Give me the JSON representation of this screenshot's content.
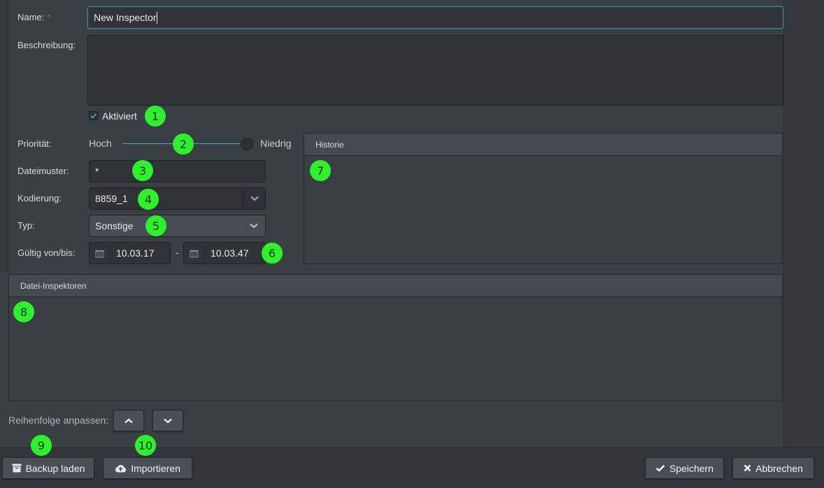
{
  "form": {
    "name_label": "Name:",
    "required_marker": "*",
    "name_value": "New Inspector",
    "description_label": "Beschreibung:",
    "description_value": "",
    "active_label": "Aktiviert",
    "active_checked": true,
    "priority_label": "Priorität:",
    "priority_high": "Hoch",
    "priority_low": "Niedrig",
    "priority_level": 1.0,
    "pattern_label": "Dateimuster:",
    "pattern_value": "*",
    "encoding_label": "Kodierung:",
    "encoding_value": "8859_1",
    "type_label": "Typ:",
    "type_value": "Sonstige",
    "valid_label": "Gültig von/bis:",
    "valid_from": "10.03.17",
    "valid_separator": "-",
    "valid_to": "10.03.47"
  },
  "history_panel": {
    "title": "Historie"
  },
  "inspectors_panel": {
    "title": "Datei-Inspektoren"
  },
  "order": {
    "label": "Reihenfolge anpassen:"
  },
  "footer": {
    "backup_label": "Backup laden",
    "import_label": "Importieren",
    "save_label": "Speichern",
    "cancel_label": "Abbrechen"
  },
  "badges": [
    "1",
    "2",
    "3",
    "4",
    "5",
    "6",
    "7",
    "8",
    "9",
    "10"
  ],
  "colors": {
    "badge": "#2cf22c",
    "accent": "#3f8aa8",
    "required": "#e2473f"
  },
  "icons": {
    "check": "check-icon",
    "calendar": "calendar-icon",
    "chevron_down": "chevron-down-icon",
    "chevron_up": "chevron-up-icon",
    "archive": "archive-icon",
    "cloud_upload": "cloud-upload-icon",
    "close": "close-icon"
  }
}
